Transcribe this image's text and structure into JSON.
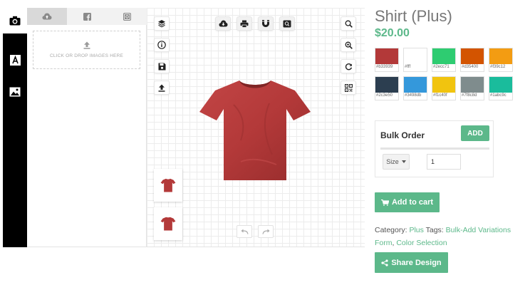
{
  "sidebar": {
    "items": [
      {
        "icon": "camera-icon",
        "active": true
      },
      {
        "icon": "text-icon",
        "active": false
      },
      {
        "icon": "image-icon",
        "active": false
      }
    ]
  },
  "panel": {
    "tabs": [
      {
        "icon": "cloud-upload-icon",
        "active": true
      },
      {
        "icon": "facebook-icon",
        "active": false
      },
      {
        "icon": "instagram-icon",
        "active": false
      }
    ],
    "dropzone_label": "CLICK OR DROP IMAGES HERE"
  },
  "toolbar": {
    "left": [
      "layers-icon",
      "info-icon",
      "save-icon",
      "upload-icon"
    ],
    "top": [
      "cloud-download-icon",
      "print-icon",
      "magnet-icon",
      "zoom-box-icon"
    ],
    "right": [
      "search-icon",
      "zoom-in-icon",
      "refresh-icon",
      "qr-code-icon"
    ],
    "history": [
      "undo-icon",
      "redo-icon"
    ]
  },
  "product": {
    "title": "Shirt (Plus)",
    "price": "$20.00",
    "tshirt_color": "#b33939"
  },
  "swatches": [
    {
      "color": "#b33939",
      "label": "#b33939"
    },
    {
      "color": "#ffffff",
      "label": "#fff"
    },
    {
      "color": "#2ecc71",
      "label": "#2ecc71"
    },
    {
      "color": "#d35400",
      "label": "#d35400"
    },
    {
      "color": "#f39c12",
      "label": "#f39c12"
    },
    {
      "color": "#2c3e50",
      "label": "#2c3e50"
    },
    {
      "color": "#3498db",
      "label": "#3498db"
    },
    {
      "color": "#f1c40f",
      "label": "#f1c40f"
    },
    {
      "color": "#7f8c8d",
      "label": "#7f8c8d"
    },
    {
      "color": "#1abc9c",
      "label": "#1abc9c"
    }
  ],
  "bulk_order": {
    "title": "Bulk Order",
    "add_label": "ADD",
    "size_value": "Size",
    "quantity_value": "1"
  },
  "cart": {
    "add_to_cart_label": "Add to cart"
  },
  "meta": {
    "category_label": "Category:",
    "category_value": "Plus",
    "tags_label": "Tags:",
    "tag_1": "Bulk-Add Variations Form",
    "tag_2": "Color Selection"
  },
  "share": {
    "label": "Share Design"
  },
  "colors": {
    "accent": "#5cb88a",
    "sidebar": "#000000"
  }
}
